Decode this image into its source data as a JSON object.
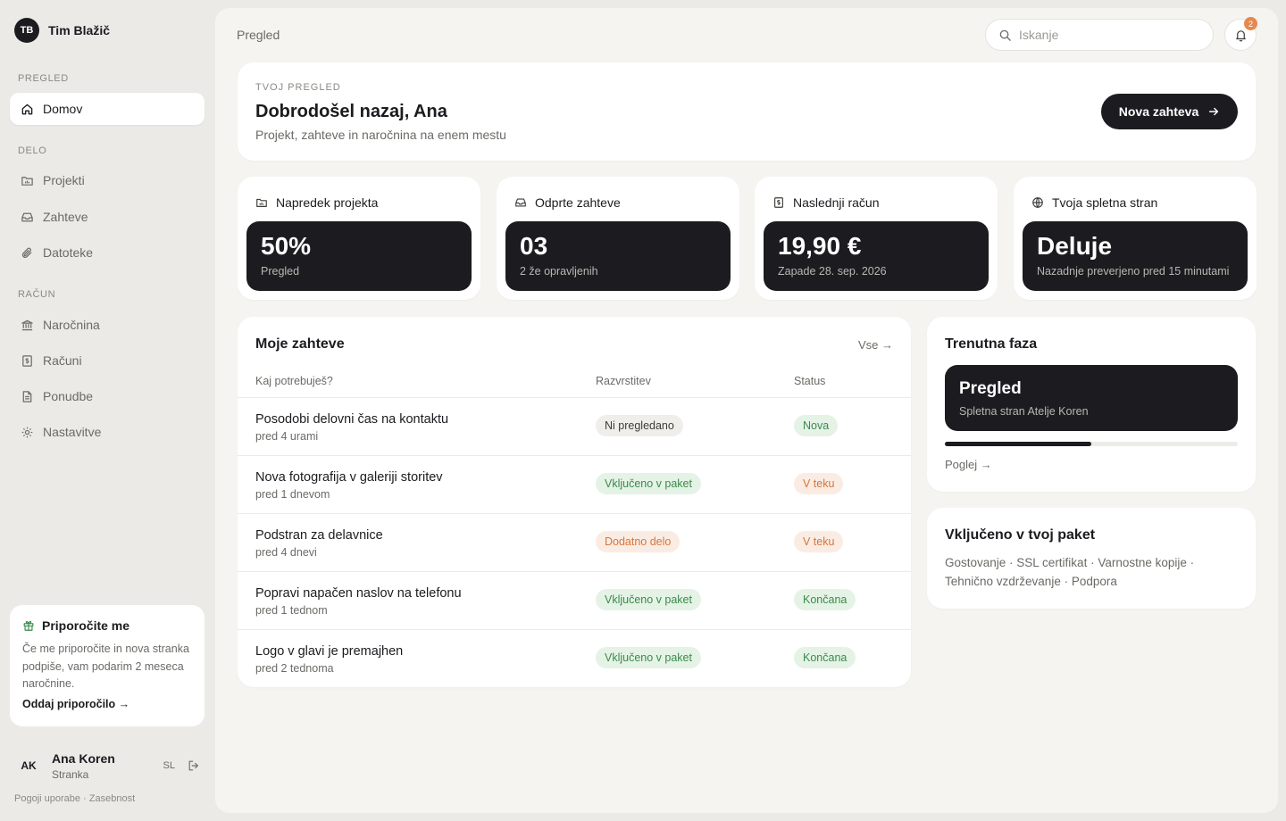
{
  "sidebar": {
    "brand": {
      "initials": "TB",
      "name": "Tim Blažič"
    },
    "sections": {
      "overview": "PREGLED",
      "work": "DELO",
      "billing": "RAČUN"
    },
    "items": {
      "home": "Domov",
      "projects": "Projekti",
      "requests": "Zahteve",
      "files": "Datoteke",
      "subscription": "Naročnina",
      "invoices": "Računi",
      "offers": "Ponudbe",
      "settings": "Nastavitve"
    },
    "referral": {
      "title": "Priporočite me",
      "text": "Če me priporočite in nova stranka podpiše, vam podarim 2 meseca naročnine.",
      "link": "Oddaj priporočilo →"
    },
    "user": {
      "initials": "AK",
      "name": "Ana Koren",
      "role": "Stranka",
      "lang": "SL"
    },
    "footer": "Pogoji uporabe · Zasebnost"
  },
  "header": {
    "breadcrumb": "Pregled",
    "search_placeholder": "Iskanje",
    "notification_count": "2"
  },
  "welcome": {
    "eyebrow": "TVOJ PREGLED",
    "title": "Dobrodošel nazaj, Ana",
    "subtitle": "Projekt, zahteve in naročnina na enem mestu",
    "cta": "Nova zahteva"
  },
  "stats": [
    {
      "label": "Napredek projekta",
      "value": "50%",
      "sub": "Pregled"
    },
    {
      "label": "Odprte zahteve",
      "value": "03",
      "sub": "2 že opravljenih"
    },
    {
      "label": "Naslednji račun",
      "value": "19,90 €",
      "sub": "Zapade 28. sep. 2026"
    },
    {
      "label": "Tvoja spletna stran",
      "value": "Deluje",
      "sub": "Nazadnje preverjeno pred 15 minutami"
    }
  ],
  "requests": {
    "title": "Moje zahteve",
    "all_link": "Vse →",
    "columns": [
      "Kaj potrebuješ?",
      "Razvrstitev",
      "Status"
    ],
    "rows": [
      {
        "title": "Posodobi delovni čas na kontaktu",
        "time": "pred 4 urami",
        "category": "Ni pregledano",
        "status": "Nova"
      },
      {
        "title": "Nova fotografija v galeriji storitev",
        "time": "pred 1 dnevom",
        "category": "Vključeno v paket",
        "status": "V teku"
      },
      {
        "title": "Podstran za delavnice",
        "time": "pred 4 dnevi",
        "category": "Dodatno delo",
        "status": "V teku"
      },
      {
        "title": "Popravi napačen naslov na telefonu",
        "time": "pred 1 tednom",
        "category": "Vključeno v paket",
        "status": "Končana"
      },
      {
        "title": "Logo v glavi je premajhen",
        "time": "pred 2 tednoma",
        "category": "Vključeno v paket",
        "status": "Končana"
      }
    ]
  },
  "phase": {
    "title": "Trenutna faza",
    "name": "Pregled",
    "subtitle": "Spletna stran Atelje Koren",
    "progress": 0.5,
    "link": "Poglej →"
  },
  "package": {
    "title": "Vključeno v tvoj paket",
    "items": "Gostovanje · SSL certifikat · Varnostne kopije · Tehnično vzdrževanje · Podpora"
  },
  "colors": {
    "dark": "#1c1b1f",
    "green_text": "#3b8a4a",
    "green_bg": "#e5f3e7",
    "orange_text": "#d2773e",
    "orange_bg": "#fbece3",
    "gray_bg": "#efeeeb",
    "badge": "#e7884e"
  },
  "icons": {
    "home": "home-icon",
    "projects": "folder-chart-icon",
    "requests": "inbox-icon",
    "files": "paperclip-icon",
    "subscription": "bank-icon",
    "invoices": "receipt-icon",
    "offers": "document-icon",
    "settings": "gear-icon",
    "referral": "gift-icon",
    "logout": "logout-icon",
    "search": "search-icon",
    "bell": "bell-icon",
    "cta": "arrow-right-icon",
    "website": "globe-icon"
  }
}
